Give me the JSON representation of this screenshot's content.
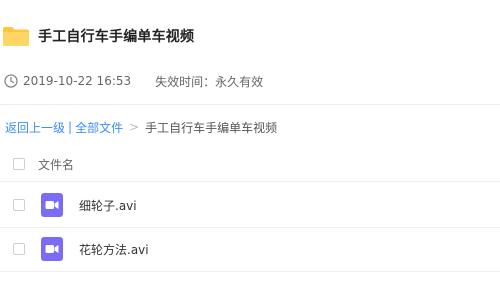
{
  "header": {
    "title": "手工自行车手编单车视频",
    "folder_icon": "folder-icon",
    "folder_color": "#ffc53d"
  },
  "meta": {
    "clock_icon": "clock-icon",
    "date": "2019-10-22 16:53",
    "expire": "失效时间：永久有效"
  },
  "breadcrumb": {
    "back": "返回上一级",
    "separator": "|",
    "all_files": "全部文件",
    "arrow": ">",
    "current": "手工自行车手编单车视频",
    "link_color": "#3b8cff"
  },
  "file_list": {
    "column_header": "文件名",
    "files": [
      {
        "name": "细轮子.avi",
        "icon": "video-file-icon"
      },
      {
        "name": "花轮方法.avi",
        "icon": "video-file-icon"
      }
    ],
    "video_icon_color": "#7b6cf6"
  }
}
